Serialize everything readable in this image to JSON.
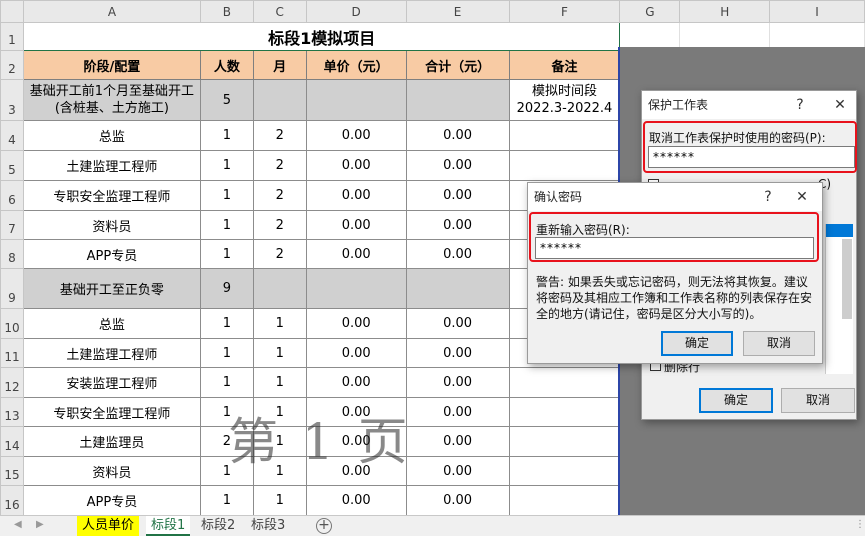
{
  "columns": [
    "A",
    "B",
    "C",
    "D",
    "E",
    "F",
    "G",
    "H",
    "I"
  ],
  "rows": [
    "1",
    "2",
    "3",
    "4",
    "5",
    "6",
    "7",
    "8",
    "9",
    "10",
    "11",
    "12",
    "13",
    "14",
    "15",
    "16"
  ],
  "sheet": {
    "title": "标段1模拟项目",
    "headers": [
      "阶段/配置",
      "人数",
      "月",
      "单价（元）",
      "合计（元）",
      "备注"
    ],
    "row3": {
      "a_line1": "基础开工前1个月至基础开工",
      "a_line2": "(含桩基、土方施工)",
      "b": "5",
      "f_line1": "模拟时间段",
      "f_line2": "2022.3-2022.4"
    },
    "group1": [
      {
        "role": "总监",
        "count": "1",
        "months": "2",
        "price": "0.00",
        "total": "0.00"
      },
      {
        "role": "土建监理工程师",
        "count": "1",
        "months": "2",
        "price": "0.00",
        "total": "0.00"
      },
      {
        "role": "专职安全监理工程师",
        "count": "1",
        "months": "2",
        "price": "0.00",
        "total": "0.00"
      },
      {
        "role": "资料员",
        "count": "1",
        "months": "2",
        "price": "0.00",
        "total": "0.00"
      },
      {
        "role": "APP专员",
        "count": "1",
        "months": "2",
        "price": "0.00",
        "total": "0.00"
      }
    ],
    "row9": {
      "a": "基础开工至正负零",
      "b": "9"
    },
    "group2": [
      {
        "role": "总监",
        "count": "1",
        "months": "1",
        "price": "0.00",
        "total": "0.00"
      },
      {
        "role": "土建监理工程师",
        "count": "1",
        "months": "1",
        "price": "0.00",
        "total": "0.00"
      },
      {
        "role": "安装监理工程师",
        "count": "1",
        "months": "1",
        "price": "0.00",
        "total": "0.00"
      },
      {
        "role": "专职安全监理工程师",
        "count": "1",
        "months": "1",
        "price": "0.00",
        "total": "0.00"
      },
      {
        "role": "土建监理员",
        "count": "2",
        "months": "1",
        "price": "0.00",
        "total": "0.00"
      },
      {
        "role": "资料员",
        "count": "1",
        "months": "1",
        "price": "0.00",
        "total": "0.00"
      },
      {
        "role": "APP专员",
        "count": "1",
        "months": "1",
        "price": "0.00",
        "total": "0.00"
      }
    ]
  },
  "watermark": "第 1 页",
  "tabs": [
    "人员单价",
    "标段1",
    "标段2",
    "标段3"
  ],
  "add_sheet": "+",
  "protect_dialog": {
    "title": "保护工作表",
    "help": "?",
    "close": "✕",
    "password_label": "取消工作表保护时使用的密码(P):",
    "password_value": "******",
    "partial_checkbox_text": "C)",
    "partial_option": "删除行",
    "ok": "确定",
    "cancel": "取消"
  },
  "confirm_dialog": {
    "title": "确认密码",
    "help": "?",
    "close": "✕",
    "reenter_label": "重新输入密码(R):",
    "password_value": "******",
    "warning": "警告: 如果丢失或忘记密码，则无法将其恢复。建议将密码及其相应工作簿和工作表名称的列表保存在安全的地方(请记住，密码是区分大小写的)。",
    "ok": "确定",
    "cancel": "取消"
  },
  "colors": {
    "header_fill": "#f8cba4",
    "gray_fill": "#d0d0d0",
    "highlight": "#e8121c",
    "accent": "#217346",
    "tab_yellow": "#ffff00"
  }
}
